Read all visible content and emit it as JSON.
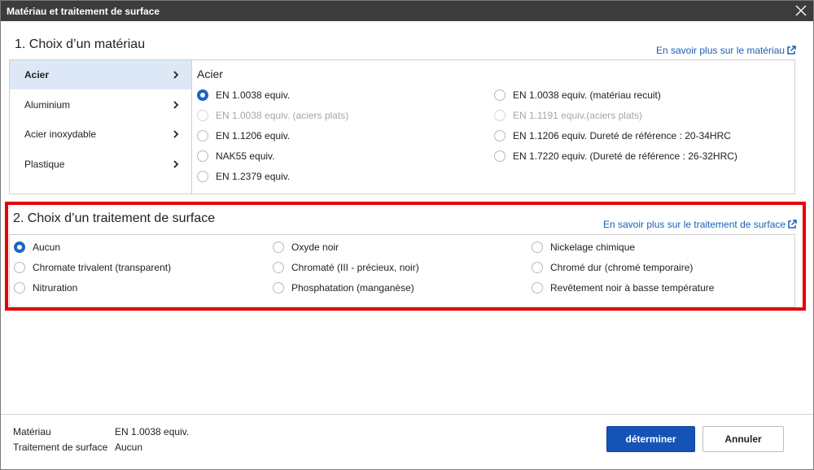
{
  "window": {
    "title": "Matériau et traitement de surface"
  },
  "material": {
    "heading": "1. Choix d’un matériau",
    "more_link": "En savoir plus sur le matériau",
    "categories": [
      "Acier",
      "Aluminium",
      "Acier inoxydable",
      "Plastique"
    ],
    "selected_category": "Acier",
    "grades_title": "Acier",
    "grades": [
      {
        "label": "EN 1.0038 equiv.",
        "checked": true,
        "disabled": false
      },
      {
        "label": "EN 1.0038 equiv. (aciers plats)",
        "checked": false,
        "disabled": true
      },
      {
        "label": "EN 1.1206 equiv.",
        "checked": false,
        "disabled": false
      },
      {
        "label": "NAK55 equiv.",
        "checked": false,
        "disabled": false
      },
      {
        "label": "EN 1.2379 equiv.",
        "checked": false,
        "disabled": false
      },
      {
        "label": "EN 1.0038 equiv. (matériau recuit)",
        "checked": false,
        "disabled": false
      },
      {
        "label": "EN 1.1191 equiv.(aciers plats)",
        "checked": false,
        "disabled": true
      },
      {
        "label": "EN 1.1206 equiv. Dureté de référence : 20-34HRC",
        "checked": false,
        "disabled": false
      },
      {
        "label": "EN 1.7220 equiv. (Dureté de référence : 26-32HRC)",
        "checked": false,
        "disabled": false
      }
    ]
  },
  "surface": {
    "heading": "2. Choix d’un traitement de surface",
    "more_link": "En savoir plus sur le traitement de surface",
    "options": [
      {
        "label": "Aucun",
        "checked": true
      },
      {
        "label": "Chromate trivalent (transparent)",
        "checked": false
      },
      {
        "label": "Nitruration",
        "checked": false
      },
      {
        "label": "Oxyde noir",
        "checked": false
      },
      {
        "label": "Chromaté (III - précieux, noir)",
        "checked": false
      },
      {
        "label": "Phosphatation (manganèse)",
        "checked": false
      },
      {
        "label": "Nickelage chimique",
        "checked": false
      },
      {
        "label": "Chromé dur (chromé temporaire)",
        "checked": false
      },
      {
        "label": "Revêtement noir à basse température",
        "checked": false
      }
    ]
  },
  "summary": {
    "material_label": "Matériau",
    "material_value": "EN 1.0038 equiv.",
    "surface_label": "Traitement de surface",
    "surface_value": "Aucun"
  },
  "buttons": {
    "confirm": "déterminer",
    "cancel": "Annuler"
  },
  "colors": {
    "accent": "#1553b6",
    "highlight": "#e60000",
    "selected_bg": "#dde8f7"
  },
  "icons": {
    "close": "close-icon",
    "external": "external-link-icon",
    "chevron": "chevron-right-icon"
  }
}
